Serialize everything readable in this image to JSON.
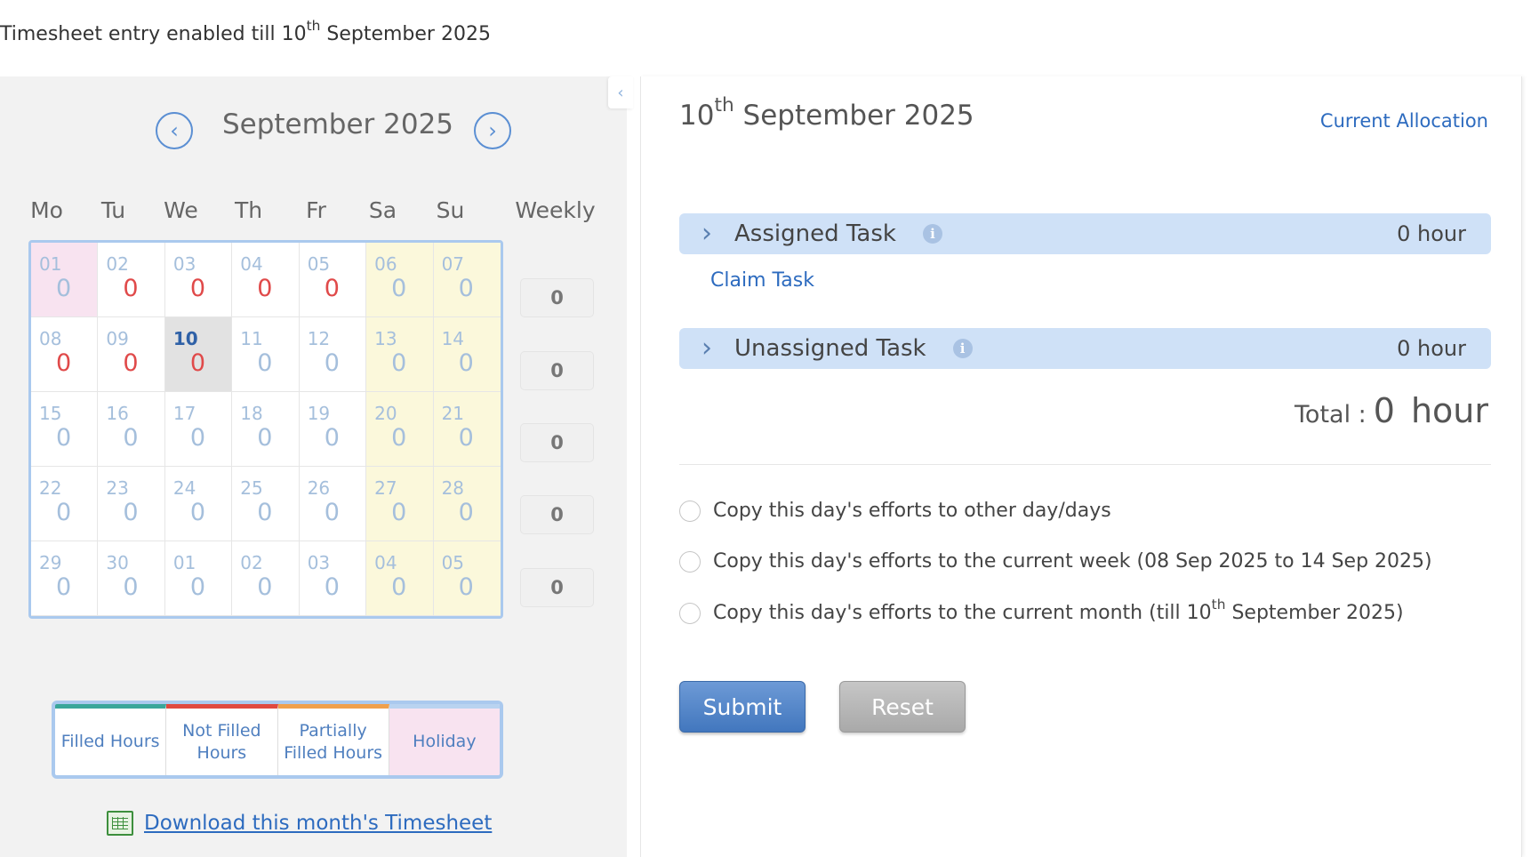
{
  "banner": {
    "text": "Timesheet entry enabled till 10",
    "sup": "th",
    "text_after": " September 2025"
  },
  "calendar": {
    "month_title": "September 2025",
    "prev_icon": "chevron-left-icon",
    "next_icon": "chevron-right-icon",
    "weekdays": [
      "Mo",
      "Tu",
      "We",
      "Th",
      "Fr",
      "Sa",
      "Su"
    ],
    "weekly_label": "Weekly",
    "weeks": [
      {
        "weekly": "0",
        "days": [
          {
            "day": "01",
            "hours": "0",
            "type": "holiday"
          },
          {
            "day": "02",
            "hours": "0",
            "type": "not-filled"
          },
          {
            "day": "03",
            "hours": "0",
            "type": "not-filled"
          },
          {
            "day": "04",
            "hours": "0",
            "type": "not-filled"
          },
          {
            "day": "05",
            "hours": "0",
            "type": "not-filled"
          },
          {
            "day": "06",
            "hours": "0",
            "type": "weekend"
          },
          {
            "day": "07",
            "hours": "0",
            "type": "weekend"
          }
        ]
      },
      {
        "weekly": "0",
        "days": [
          {
            "day": "08",
            "hours": "0",
            "type": "not-filled"
          },
          {
            "day": "09",
            "hours": "0",
            "type": "not-filled"
          },
          {
            "day": "10",
            "hours": "0",
            "type": "selected"
          },
          {
            "day": "11",
            "hours": "0",
            "type": "future"
          },
          {
            "day": "12",
            "hours": "0",
            "type": "future"
          },
          {
            "day": "13",
            "hours": "0",
            "type": "weekend"
          },
          {
            "day": "14",
            "hours": "0",
            "type": "weekend"
          }
        ]
      },
      {
        "weekly": "0",
        "days": [
          {
            "day": "15",
            "hours": "0",
            "type": "future"
          },
          {
            "day": "16",
            "hours": "0",
            "type": "future"
          },
          {
            "day": "17",
            "hours": "0",
            "type": "future"
          },
          {
            "day": "18",
            "hours": "0",
            "type": "future"
          },
          {
            "day": "19",
            "hours": "0",
            "type": "future"
          },
          {
            "day": "20",
            "hours": "0",
            "type": "weekend"
          },
          {
            "day": "21",
            "hours": "0",
            "type": "weekend"
          }
        ]
      },
      {
        "weekly": "0",
        "days": [
          {
            "day": "22",
            "hours": "0",
            "type": "future"
          },
          {
            "day": "23",
            "hours": "0",
            "type": "future"
          },
          {
            "day": "24",
            "hours": "0",
            "type": "future"
          },
          {
            "day": "25",
            "hours": "0",
            "type": "future"
          },
          {
            "day": "26",
            "hours": "0",
            "type": "future"
          },
          {
            "day": "27",
            "hours": "0",
            "type": "weekend"
          },
          {
            "day": "28",
            "hours": "0",
            "type": "weekend"
          }
        ]
      },
      {
        "weekly": "0",
        "days": [
          {
            "day": "29",
            "hours": "0",
            "type": "future"
          },
          {
            "day": "30",
            "hours": "0",
            "type": "future"
          },
          {
            "day": "01",
            "hours": "0",
            "type": "future"
          },
          {
            "day": "02",
            "hours": "0",
            "type": "future"
          },
          {
            "day": "03",
            "hours": "0",
            "type": "future"
          },
          {
            "day": "04",
            "hours": "0",
            "type": "weekend"
          },
          {
            "day": "05",
            "hours": "0",
            "type": "weekend"
          }
        ]
      }
    ]
  },
  "legend": [
    {
      "label": "Filled Hours",
      "color": "#3aa69a"
    },
    {
      "label": "Not Filled Hours",
      "color": "#e0493f"
    },
    {
      "label": "Partially Filled Hours",
      "color": "#f0a04b"
    },
    {
      "label": "Holiday",
      "color": "#b9d3f0"
    }
  ],
  "download": {
    "label": "Download this month's Timesheet",
    "icon": "excel-icon"
  },
  "day_panel": {
    "day_num": "10",
    "day_sup": "th",
    "day_rest": " September 2025",
    "current_allocation": "Current Allocation",
    "assigned": {
      "label": "Assigned Task",
      "hours": "0 hour"
    },
    "claim_task": "Claim Task",
    "unassigned": {
      "label": "Unassigned Task",
      "hours": "0 hour"
    },
    "total_label": "Total :",
    "total_value": "0",
    "total_unit": "hour",
    "copy_options": {
      "other_days": "Copy this day's efforts to other day/days",
      "current_week": "Copy this day's efforts to the current week (08 Sep 2025 to 14 Sep 2025)",
      "current_month_prefix": "Copy this day's efforts to the current month (till 10",
      "current_month_sup": "th",
      "current_month_suffix": " September 2025)"
    },
    "submit_label": "Submit",
    "reset_label": "Reset"
  },
  "colors": {
    "accent": "#2d6bbf",
    "not_filled": "#e04a4a",
    "weekend": "#fbf8db",
    "holiday": "#f8e3f0"
  }
}
